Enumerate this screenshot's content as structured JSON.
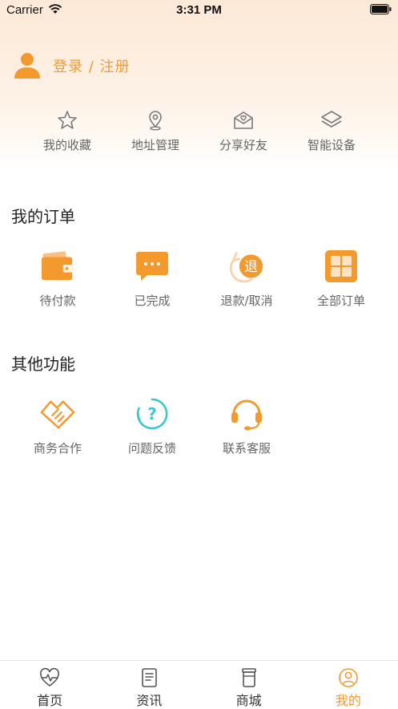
{
  "status_bar": {
    "carrier": "Carrier",
    "time": "3:31 PM",
    "wifi_icon": "wifi-icon",
    "battery_icon": "battery-icon"
  },
  "user": {
    "avatar_icon": "user-avatar-icon",
    "login_label": "登录 / 注册"
  },
  "quick_links": [
    {
      "label": "我的收藏",
      "icon": "star-icon"
    },
    {
      "label": "地址管理",
      "icon": "location-pin-icon"
    },
    {
      "label": "分享好友",
      "icon": "share-envelope-heart-icon"
    },
    {
      "label": "智能设备",
      "icon": "layers-icon"
    }
  ],
  "orders": {
    "title": "我的订单",
    "items": [
      {
        "label": "待付款",
        "icon": "wallet-icon"
      },
      {
        "label": "已完成",
        "icon": "chat-bubble-icon"
      },
      {
        "label": "退款/取消",
        "icon": "refund-icon",
        "glyph": "退"
      },
      {
        "label": "全部订单",
        "icon": "all-orders-grid-icon"
      }
    ]
  },
  "other": {
    "title": "其他功能",
    "items": [
      {
        "label": "商务合作",
        "icon": "handshake-icon"
      },
      {
        "label": "问题反馈",
        "icon": "question-icon",
        "glyph": "?"
      },
      {
        "label": "联系客服",
        "icon": "headset-icon"
      }
    ]
  },
  "tabbar": {
    "active": 3,
    "tabs": [
      {
        "label": "首页",
        "icon": "heart-pulse-icon"
      },
      {
        "label": "资讯",
        "icon": "document-icon"
      },
      {
        "label": "商城",
        "icon": "jar-icon"
      },
      {
        "label": "我的",
        "icon": "profile-circle-icon"
      }
    ]
  },
  "colors": {
    "accent": "#f39a2f",
    "icon_gray": "#7a7a7a",
    "teal": "#3ec7d0",
    "header_gradient_top": "#fde9d7"
  }
}
